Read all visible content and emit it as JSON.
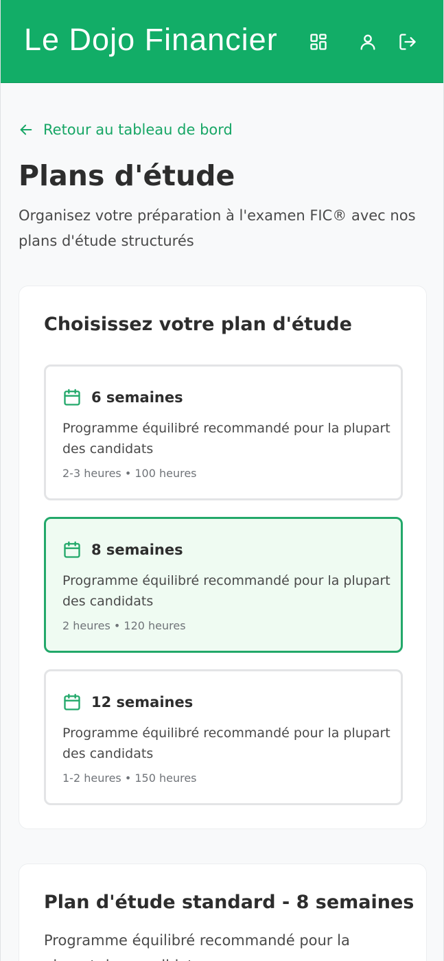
{
  "header": {
    "brand": "Le Dojo Financier",
    "icons": [
      "dashboard-icon",
      "user-icon",
      "logout-icon"
    ],
    "background": "#12ad67"
  },
  "back_link": {
    "label": "Retour au tableau de bord",
    "icon": "arrow-left-icon"
  },
  "page": {
    "title": "Plans d'étude",
    "subtitle": "Organisez votre préparation à l'examen FIC® avec nos plans d'étude structurés"
  },
  "plan_picker": {
    "title": "Choisissez votre plan d'étude",
    "plans": [
      {
        "name": "6 semaines",
        "description": "Programme équilibré recommandé pour la plupart des candidats",
        "meta": "2-3 heures • 100 heures",
        "selected": false,
        "icon": "calendar-icon"
      },
      {
        "name": "8 semaines",
        "description": "Programme équilibré recommandé pour la plupart des candidats",
        "meta": "2 heures • 120 heures",
        "selected": true,
        "icon": "calendar-icon"
      },
      {
        "name": "12 semaines",
        "description": "Programme équilibré recommandé pour la plupart des candidats",
        "meta": "1-2 heures • 150 heures",
        "selected": false,
        "icon": "calendar-icon"
      }
    ]
  },
  "selected_plan": {
    "title": "Plan d'étude standard - 8 semaines",
    "description": "Programme équilibré recommandé pour la plupart des candidats"
  },
  "colors": {
    "accent": "#12ad67",
    "selected_border": "#22a86a",
    "selected_background": "#effbf2"
  }
}
